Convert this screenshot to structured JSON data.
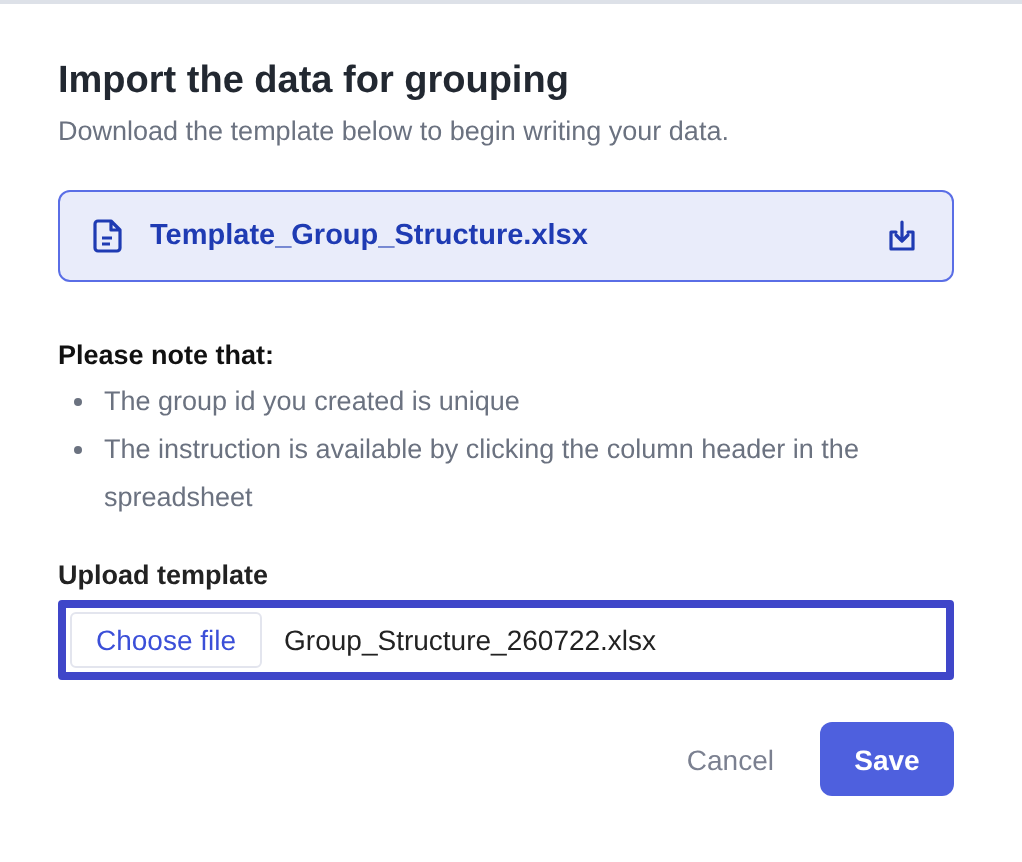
{
  "dialog": {
    "title": "Import the data for grouping",
    "subtitle": "Download the template below to begin writing your data."
  },
  "template_file": {
    "name": "Template_Group_Structure.xlsx"
  },
  "notes": {
    "heading": "Please note that:",
    "items": [
      "The group id you created is unique",
      "The instruction is available by clicking the column header in the spreadsheet"
    ]
  },
  "upload": {
    "label": "Upload template",
    "button": "Choose file",
    "value": "Group_Structure_260722.xlsx",
    "focused": true
  },
  "buttons": {
    "cancel": "Cancel",
    "save": "Save"
  }
}
